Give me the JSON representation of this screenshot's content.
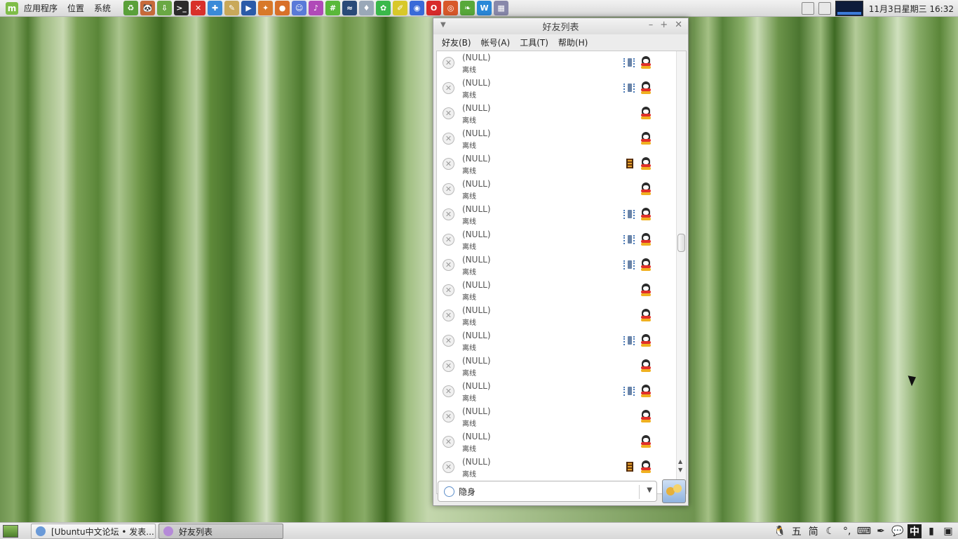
{
  "top_panel": {
    "logo": "mint-logo",
    "menus": [
      "应用程序",
      "位置",
      "系统"
    ],
    "launchers": [
      {
        "icon": "green-recycle-icon",
        "color": "#5aa03a",
        "glyph": "♻"
      },
      {
        "icon": "panda-icon",
        "color": "#c76a3a",
        "glyph": "🐼"
      },
      {
        "icon": "download-icon",
        "color": "#6aa844",
        "glyph": "⇩"
      },
      {
        "icon": "terminal-icon",
        "color": "#2b2b2b",
        "glyph": ">_"
      },
      {
        "icon": "x-app-icon",
        "color": "#d8302a",
        "glyph": "✕"
      },
      {
        "icon": "puzzle-icon",
        "color": "#3a8ad8",
        "glyph": "✚"
      },
      {
        "icon": "notepad-icon",
        "color": "#c9a85a",
        "glyph": "✎"
      },
      {
        "icon": "video-player-icon",
        "color": "#2a5aa8",
        "glyph": "▶"
      },
      {
        "icon": "network-icon",
        "color": "#d8782a",
        "glyph": "✦"
      },
      {
        "icon": "basketball-icon",
        "color": "#d8702a",
        "glyph": "●"
      },
      {
        "icon": "chat-users-icon",
        "color": "#5a7ad8",
        "glyph": "☺"
      },
      {
        "icon": "music-icon",
        "color": "#b04ab8",
        "glyph": "♪"
      },
      {
        "icon": "hashtag-icon",
        "color": "#5ab83a",
        "glyph": "#"
      },
      {
        "icon": "wave-icon",
        "color": "#2a4a78",
        "glyph": "≈"
      },
      {
        "icon": "drop-icon",
        "color": "#9aa8b8",
        "glyph": "♦"
      },
      {
        "icon": "frog-icon",
        "color": "#3ab84a",
        "glyph": "✿"
      },
      {
        "icon": "pencil-icon",
        "color": "#d8c82a",
        "glyph": "✐"
      },
      {
        "icon": "browser-icon",
        "color": "#3a6ad8",
        "glyph": "◉"
      },
      {
        "icon": "opera-icon",
        "color": "#d82a2a",
        "glyph": "O"
      },
      {
        "icon": "camera-icon",
        "color": "#d8582a",
        "glyph": "◎"
      },
      {
        "icon": "leaf-icon",
        "color": "#58a83a",
        "glyph": "❧"
      },
      {
        "icon": "wps-writer-icon",
        "color": "#2a88d8",
        "glyph": "W"
      },
      {
        "icon": "calendar-grid-icon",
        "color": "#8888aa",
        "glyph": "▦"
      }
    ],
    "clock": "11月3日星期三 16:32"
  },
  "window": {
    "title": "好友列表",
    "menubar": [
      "好友(B)",
      "帐号(A)",
      "工具(T)",
      "帮助(H)"
    ],
    "contacts": [
      {
        "name": "(NULL)",
        "status": "离线",
        "badge": "mobile"
      },
      {
        "name": "(NULL)",
        "status": "离线",
        "badge": "mobile"
      },
      {
        "name": "(NULL)",
        "status": "离线",
        "badge": ""
      },
      {
        "name": "(NULL)",
        "status": "离线",
        "badge": ""
      },
      {
        "name": "(NULL)",
        "status": "离线",
        "badge": "film"
      },
      {
        "name": "(NULL)",
        "status": "离线",
        "badge": ""
      },
      {
        "name": "(NULL)",
        "status": "离线",
        "badge": "mobile"
      },
      {
        "name": "(NULL)",
        "status": "离线",
        "badge": "mobile"
      },
      {
        "name": "(NULL)",
        "status": "离线",
        "badge": "mobile"
      },
      {
        "name": "(NULL)",
        "status": "离线",
        "badge": ""
      },
      {
        "name": "(NULL)",
        "status": "离线",
        "badge": ""
      },
      {
        "name": "(NULL)",
        "status": "离线",
        "badge": "mobile"
      },
      {
        "name": "(NULL)",
        "status": "离线",
        "badge": ""
      },
      {
        "name": "(NULL)",
        "status": "离线",
        "badge": "mobile"
      },
      {
        "name": "(NULL)",
        "status": "离线",
        "badge": ""
      },
      {
        "name": "(NULL)",
        "status": "离线",
        "badge": ""
      },
      {
        "name": "(NULL)",
        "status": "离线",
        "badge": "film"
      }
    ],
    "status_selector": {
      "value": "隐身"
    }
  },
  "taskbar": {
    "tasks": [
      {
        "label": "[Ubuntu中文论坛 • 发表...",
        "active": false,
        "icon_color": "#6a9ad8"
      },
      {
        "label": "好友列表",
        "active": true,
        "icon_color": "#b58ad8"
      }
    ],
    "ime": [
      "五",
      "简",
      "☾",
      "°,"
    ],
    "ime_lang": "中"
  }
}
